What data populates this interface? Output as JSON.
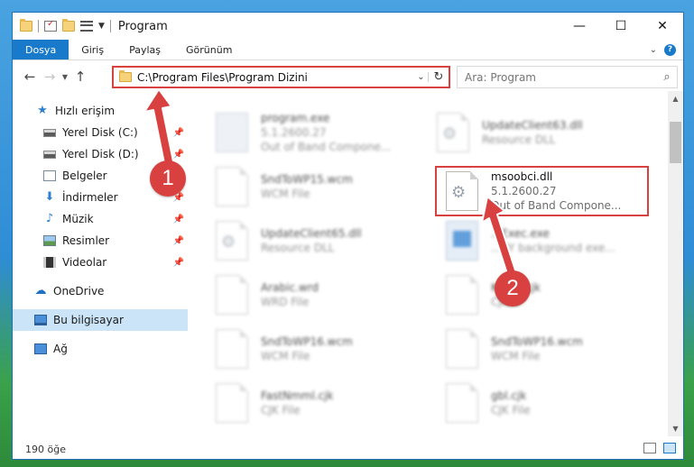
{
  "window": {
    "title": "Program",
    "controls": {
      "minimize": "—",
      "maximize": "☐",
      "close": "✕"
    }
  },
  "ribbon": {
    "tabs": [
      {
        "label": "Dosya"
      },
      {
        "label": "Giriş"
      },
      {
        "label": "Paylaş"
      },
      {
        "label": "Görünüm"
      }
    ]
  },
  "navbar": {
    "address": "C:\\Program Files\\Program Dizini",
    "search_placeholder": "Ara: Program"
  },
  "sidebar": {
    "items": [
      {
        "label": "Hızlı erişim",
        "icon": "star-icon"
      },
      {
        "label": "Yerel Disk (C:)",
        "icon": "disk-icon",
        "pinned": true
      },
      {
        "label": "Yerel Disk (D:)",
        "icon": "disk-icon",
        "pinned": true
      },
      {
        "label": "Belgeler",
        "icon": "documents-icon",
        "pinned": true
      },
      {
        "label": "İndirmeler",
        "icon": "download-icon",
        "pinned": true
      },
      {
        "label": "Müzik",
        "icon": "music-icon",
        "pinned": true
      },
      {
        "label": "Resimler",
        "icon": "pictures-icon",
        "pinned": true
      },
      {
        "label": "Videolar",
        "icon": "videos-icon",
        "pinned": true
      },
      {
        "label": "OneDrive",
        "icon": "cloud-icon"
      },
      {
        "label": "Bu bilgisayar",
        "icon": "computer-icon",
        "selected": true
      },
      {
        "label": "Ağ",
        "icon": "network-icon"
      }
    ]
  },
  "files": [
    {
      "name": "program.exe",
      "line2": "5.1.2600.27",
      "line3": "Out of Band Compone...",
      "icon": "exe-icon",
      "blurred": true
    },
    {
      "name": "UpdateClient63.dll",
      "line2": "Resource DLL",
      "line3": "",
      "icon": "dll-gear-icon",
      "blurred": true
    },
    {
      "name": "SndToWP15.wcm",
      "line2": "WCM File",
      "line3": "",
      "icon": "file-icon",
      "blurred": true
    },
    {
      "name": "msoobci.dll",
      "line2": "5.1.2600.27",
      "line3": "Out of Band Compone...",
      "icon": "dll-gear-icon",
      "blurred": false,
      "highlighted": true
    },
    {
      "name": "UpdateClient65.dll",
      "line2": "Resource DLL",
      "line3": "",
      "icon": "dll-gear-icon",
      "blurred": true
    },
    {
      "name": "...Exec.exe",
      "line2": "...BY background exe...",
      "line3": "",
      "icon": "windows-exe-icon",
      "blurred": true
    },
    {
      "name": "Arabic.wrd",
      "line2": "WRD File",
      "line3": "",
      "icon": "file-icon",
      "blurred": true
    },
    {
      "name": "Kore...cjk",
      "line2": "CJK...",
      "line3": "",
      "icon": "file-icon",
      "blurred": true
    },
    {
      "name": "SndToWP16.wcm",
      "line2": "WCM File",
      "line3": "",
      "icon": "file-icon",
      "blurred": true
    },
    {
      "name": "SndToWP16.wcm",
      "line2": "WCM File",
      "line3": "",
      "icon": "file-icon",
      "blurred": true
    },
    {
      "name": "FastNmml.cjk",
      "line2": "CJK File",
      "line3": "",
      "icon": "file-icon",
      "blurred": true
    },
    {
      "name": "gbl.cjk",
      "line2": "CJK File",
      "line3": "",
      "icon": "file-icon",
      "blurred": true
    }
  ],
  "status": {
    "count": "190 öğe"
  },
  "callouts": [
    {
      "number": "1"
    },
    {
      "number": "2"
    }
  ],
  "colors": {
    "accent": "#1979ca",
    "highlight_red": "#d94141",
    "selected_bg": "#cce4f7"
  }
}
